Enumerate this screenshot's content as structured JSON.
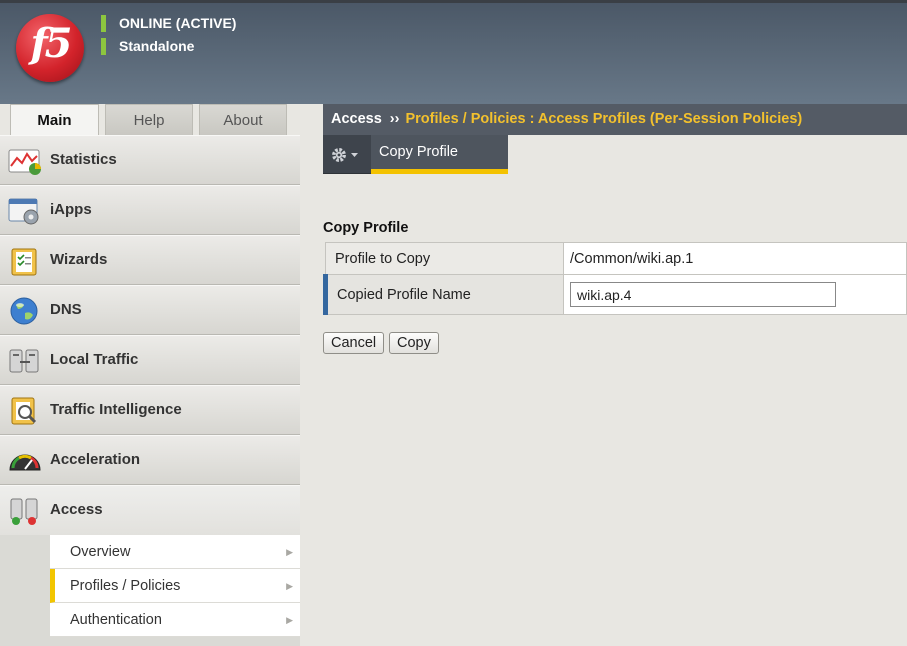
{
  "header": {
    "logo_text": "f5",
    "status_primary": "ONLINE (ACTIVE)",
    "status_secondary": "Standalone",
    "status_color": "#8dc63f"
  },
  "tabs": [
    {
      "label": "Main",
      "active": true
    },
    {
      "label": "Help",
      "active": false
    },
    {
      "label": "About",
      "active": false
    }
  ],
  "sidebar": {
    "items": [
      {
        "label": "Statistics",
        "icon": "statistics-icon"
      },
      {
        "label": "iApps",
        "icon": "iapps-icon"
      },
      {
        "label": "Wizards",
        "icon": "wizards-icon"
      },
      {
        "label": "DNS",
        "icon": "dns-globe-icon"
      },
      {
        "label": "Local Traffic",
        "icon": "local-traffic-icon"
      },
      {
        "label": "Traffic Intelligence",
        "icon": "traffic-intelligence-icon"
      },
      {
        "label": "Acceleration",
        "icon": "acceleration-gauge-icon"
      },
      {
        "label": "Access",
        "icon": "access-icon"
      }
    ],
    "subitems": [
      {
        "label": "Overview"
      },
      {
        "label": "Profiles / Policies",
        "current": true
      },
      {
        "label": "Authentication"
      }
    ]
  },
  "breadcrumb": {
    "root": "Access",
    "separator": "››",
    "path": "Profiles / Policies : Access Profiles (Per-Session Policies)",
    "accent_color": "#f3c12d"
  },
  "toolbar": {
    "active_tab": "Copy Profile",
    "accent_color": "#f3c200"
  },
  "form": {
    "title": "Copy Profile",
    "rows": [
      {
        "label": "Profile to Copy",
        "value": "/Common/wiki.ap.1"
      },
      {
        "label": "Copied Profile Name",
        "value": "wiki.ap.4"
      }
    ],
    "cancel_label": "Cancel",
    "copy_label": "Copy"
  }
}
